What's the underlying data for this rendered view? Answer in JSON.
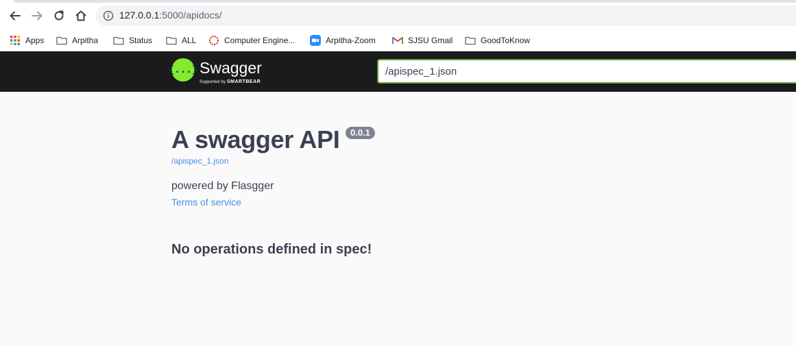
{
  "browser": {
    "url_host": "127.0.0.1",
    "url_rest": ":5000/apidocs/",
    "bookmarks": [
      {
        "label": "Apps",
        "icon": "apps-grid-icon"
      },
      {
        "label": "Arpitha",
        "icon": "folder-icon"
      },
      {
        "label": "Status",
        "icon": "folder-icon"
      },
      {
        "label": "ALL",
        "icon": "folder-icon"
      },
      {
        "label": "Computer Engine...",
        "icon": "sjsu-ring-icon"
      },
      {
        "label": "Arpitha-Zoom",
        "icon": "zoom-camera-icon"
      },
      {
        "label": "SJSU Gmail",
        "icon": "gmail-icon"
      },
      {
        "label": "GoodToKnow",
        "icon": "folder-icon"
      }
    ]
  },
  "topbar": {
    "logo_text": "Swagger",
    "logo_sub_prefix": "Supported by",
    "logo_sub_brand": "SMARTBEAR",
    "logo_glyph": "{...}",
    "spec_url_value": "/apispec_1.json"
  },
  "info": {
    "title": "A swagger API",
    "version": "0.0.1",
    "spec_link": "/apispec_1.json",
    "description": "powered by Flasgger",
    "terms_of_service": "Terms of service"
  },
  "operations": {
    "empty_message": "No operations defined in spec!"
  },
  "colors": {
    "topbar_bg": "#1b1b1b",
    "swagger_green": "#85ea2d",
    "link_blue": "#4990e2",
    "input_border": "#62a03f",
    "version_badge": "#7d8492"
  }
}
